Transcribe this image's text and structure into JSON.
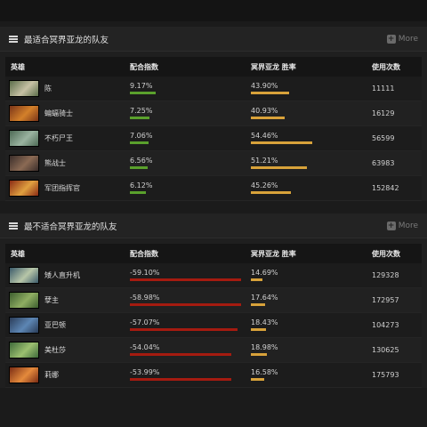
{
  "section_best": {
    "title": "最适合冥界亚龙的队友",
    "more_label": "More",
    "headers": {
      "hero": "英雄",
      "ratio": "配合指数",
      "win": "冥界亚龙 胜率",
      "count": "使用次数"
    },
    "rows": [
      {
        "name": "陈",
        "ratio": "9.17%",
        "ratio_frac": 0.22,
        "win": "43.90%",
        "win_frac": 0.45,
        "count": "11111",
        "avatar_colors": [
          "#5b6d4a",
          "#c7c1a4"
        ]
      },
      {
        "name": "蝙蝠骑士",
        "ratio": "7.25%",
        "ratio_frac": 0.17,
        "win": "40.93%",
        "win_frac": 0.4,
        "count": "16129",
        "avatar_colors": [
          "#7a3418",
          "#d3802a"
        ]
      },
      {
        "name": "不朽尸王",
        "ratio": "7.06%",
        "ratio_frac": 0.16,
        "win": "54.46%",
        "win_frac": 0.72,
        "count": "56599",
        "avatar_colors": [
          "#4d6a55",
          "#9ab3a0"
        ]
      },
      {
        "name": "熊战士",
        "ratio": "6.56%",
        "ratio_frac": 0.15,
        "win": "51.21%",
        "win_frac": 0.66,
        "count": "63983",
        "avatar_colors": [
          "#3a2d2a",
          "#8b6a54"
        ]
      },
      {
        "name": "军团指挥官",
        "ratio": "6.12%",
        "ratio_frac": 0.14,
        "win": "45.26%",
        "win_frac": 0.47,
        "count": "152842",
        "avatar_colors": [
          "#8a2a14",
          "#e0a040"
        ]
      }
    ]
  },
  "section_worst": {
    "title": "最不适合冥界亚龙的队友",
    "more_label": "More",
    "headers": {
      "hero": "英雄",
      "ratio": "配合指数",
      "win": "冥界亚龙 胜率",
      "count": "使用次数"
    },
    "rows": [
      {
        "name": "矮人直升机",
        "ratio": "-59.10%",
        "ratio_frac": 0.96,
        "win": "14.69%",
        "win_frac": 0.14,
        "count": "129328",
        "avatar_colors": [
          "#3b5a6a",
          "#b7c6a8"
        ]
      },
      {
        "name": "孽主",
        "ratio": "-58.98%",
        "ratio_frac": 0.96,
        "win": "17.64%",
        "win_frac": 0.17,
        "count": "172957",
        "avatar_colors": [
          "#3c5d2e",
          "#8fae62"
        ]
      },
      {
        "name": "亚巴顿",
        "ratio": "-57.07%",
        "ratio_frac": 0.93,
        "win": "18.43%",
        "win_frac": 0.18,
        "count": "104273",
        "avatar_colors": [
          "#2a3c58",
          "#5d86b4"
        ]
      },
      {
        "name": "美杜莎",
        "ratio": "-54.04%",
        "ratio_frac": 0.88,
        "win": "18.98%",
        "win_frac": 0.19,
        "count": "130625",
        "avatar_colors": [
          "#3e6a3a",
          "#9cc070"
        ]
      },
      {
        "name": "莉娜",
        "ratio": "-53.99%",
        "ratio_frac": 0.88,
        "win": "16.58%",
        "win_frac": 0.16,
        "count": "175793",
        "avatar_colors": [
          "#7a2c14",
          "#e48a3c"
        ]
      }
    ]
  },
  "colors": {
    "green": "#5aa02c",
    "red": "#a51b10",
    "gold": "#d8a23a"
  }
}
